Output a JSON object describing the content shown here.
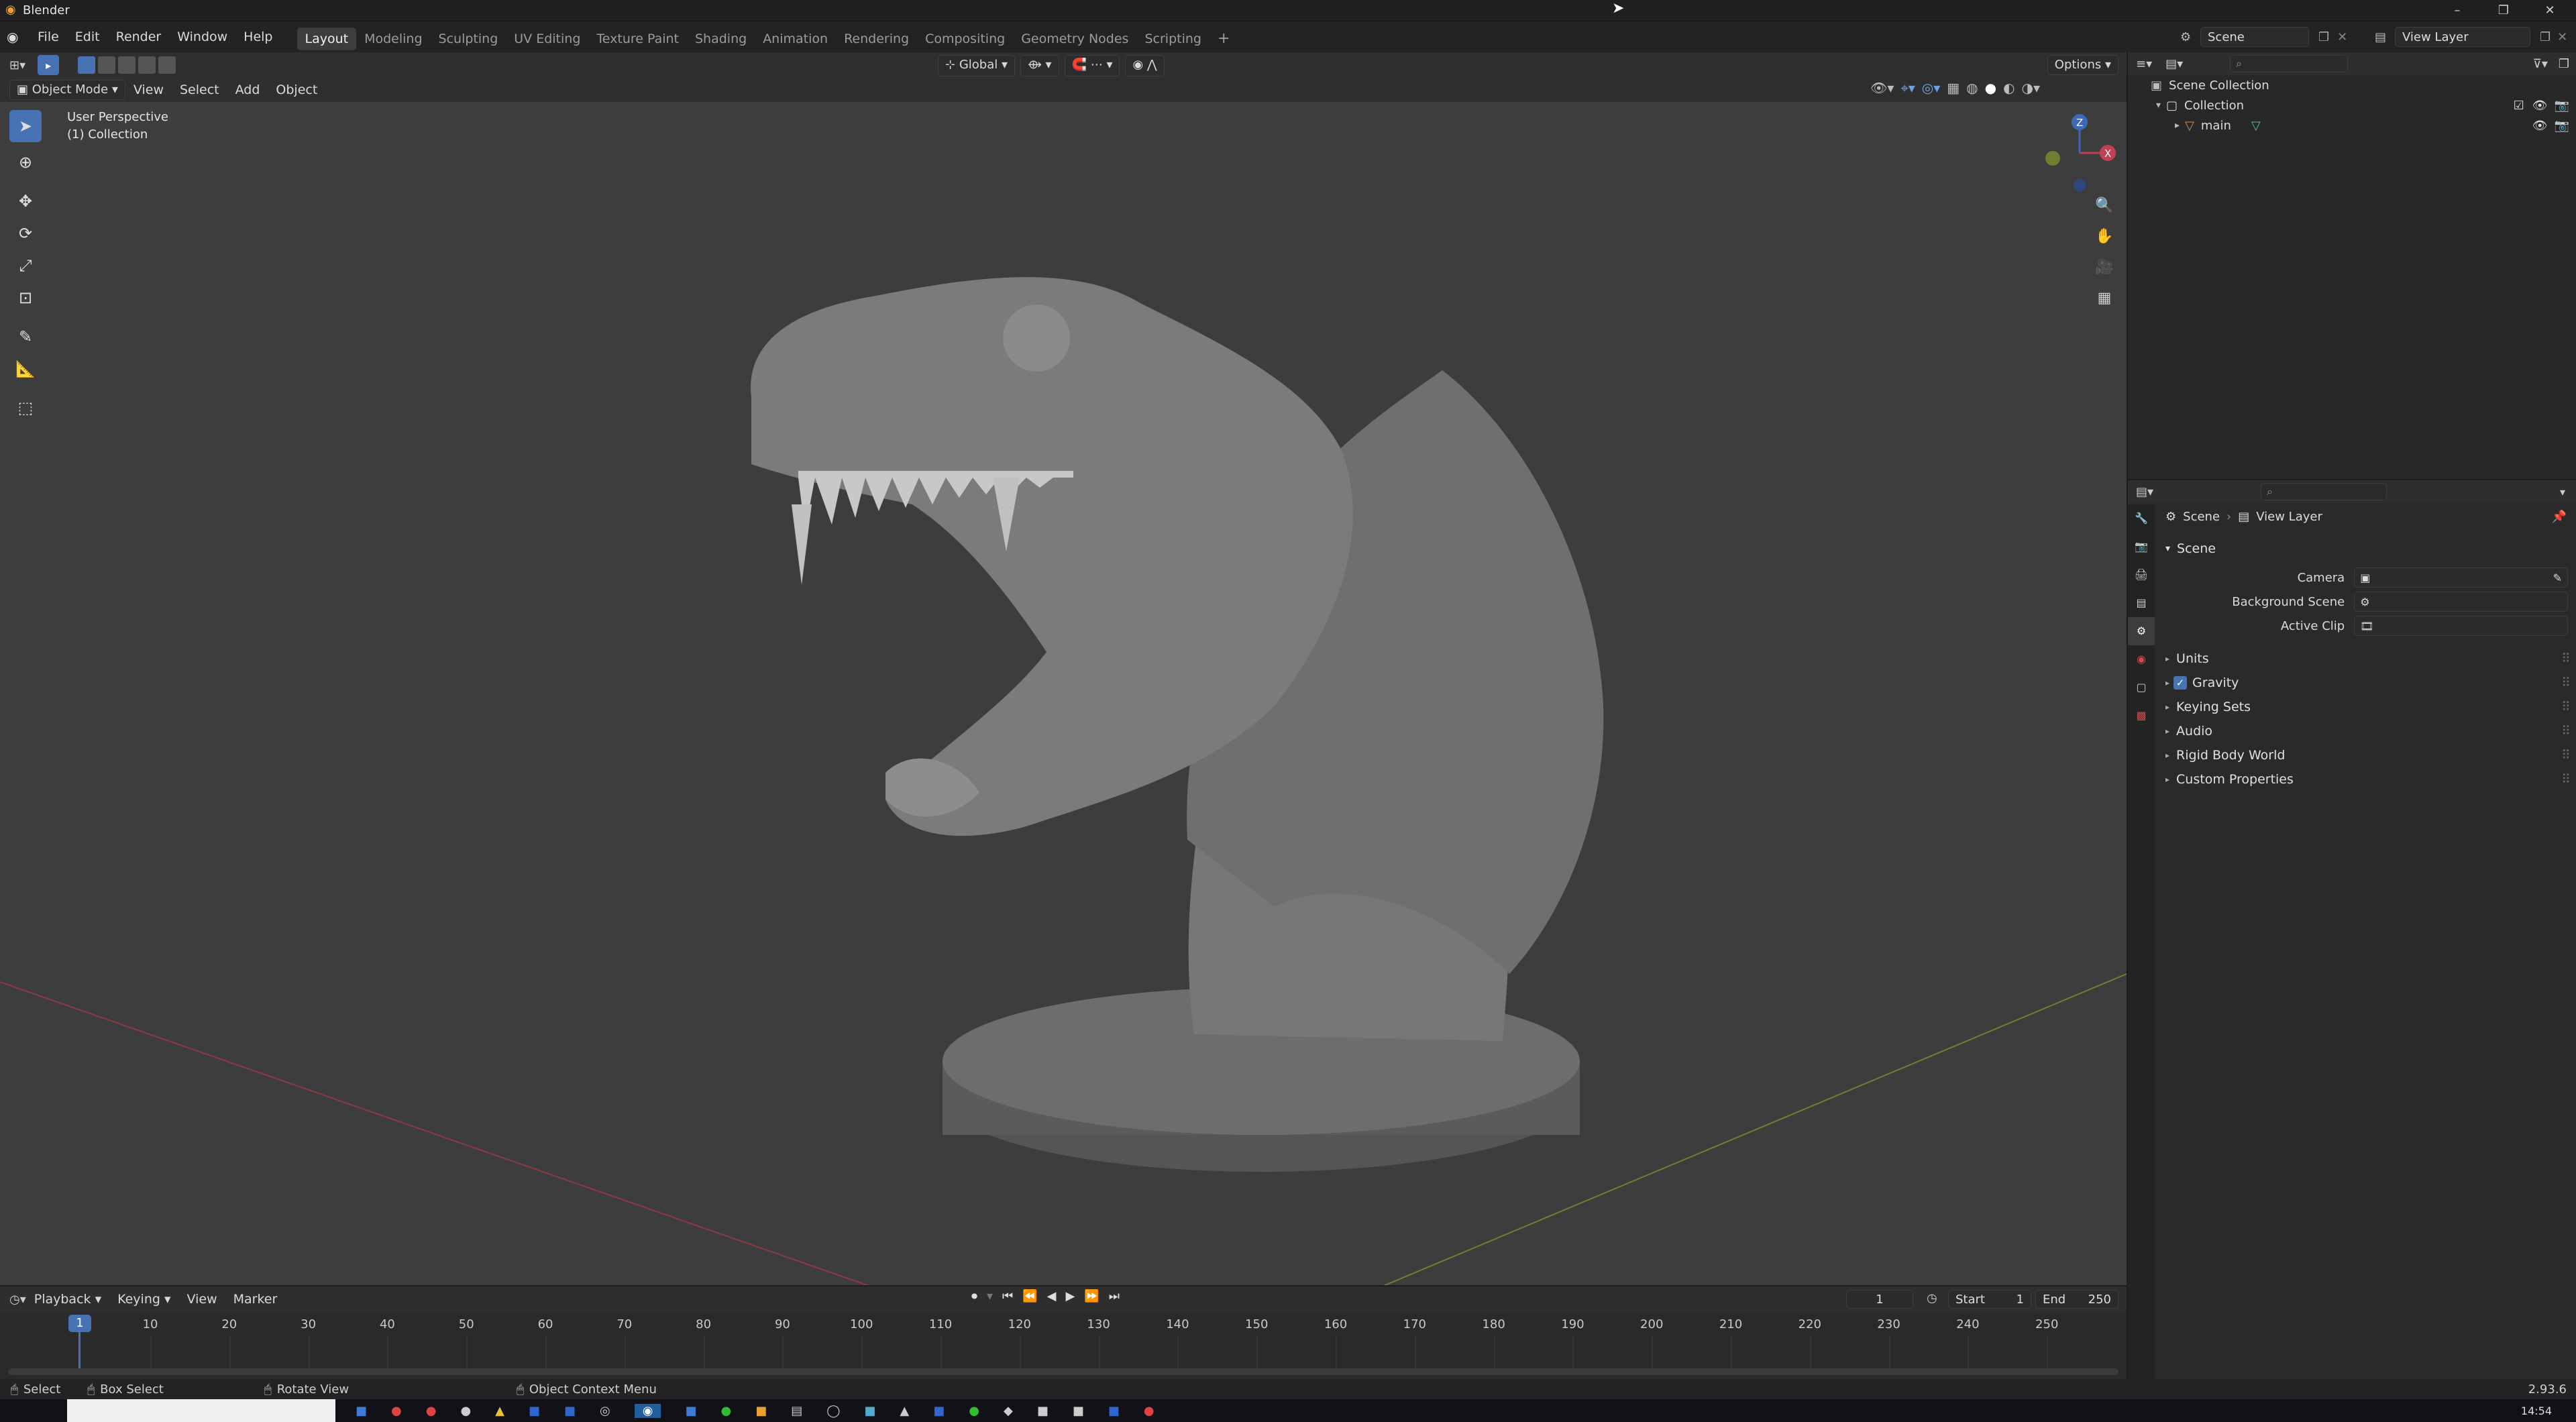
{
  "window": {
    "title": "Blender",
    "minimize": "–",
    "maximize": "❐",
    "close": "✕"
  },
  "menus": [
    "File",
    "Edit",
    "Render",
    "Window",
    "Help"
  ],
  "workspaces": [
    "Layout",
    "Modeling",
    "Sculpting",
    "UV Editing",
    "Texture Paint",
    "Shading",
    "Animation",
    "Rendering",
    "Compositing",
    "Geometry Nodes",
    "Scripting"
  ],
  "active_workspace": "Layout",
  "scene_field": "Scene",
  "viewlayer_field": "View Layer",
  "viewport_header": {
    "transform_orientation": "Global",
    "options": "Options",
    "mode": "Object Mode",
    "menus": [
      "View",
      "Select",
      "Add",
      "Object"
    ]
  },
  "viewport": {
    "perspective_label": "User Perspective",
    "collection_label": "(1) Collection",
    "axis_x": "X",
    "axis_y": "Y",
    "axis_z": "Z"
  },
  "outliner": {
    "root": "Scene Collection",
    "collection": "Collection",
    "object": "main"
  },
  "properties": {
    "breadcrumb_scene": "Scene",
    "breadcrumb_viewlayer": "View Layer",
    "section": "Scene",
    "fields": {
      "camera": "Camera",
      "background_scene": "Background Scene",
      "active_clip": "Active Clip"
    },
    "subsections": [
      "Units",
      "Gravity",
      "Keying Sets",
      "Audio",
      "Rigid Body World",
      "Custom Properties"
    ],
    "gravity_checked": true
  },
  "timeline": {
    "menus": [
      "Playback",
      "Keying",
      "View",
      "Marker"
    ],
    "current_frame": "1",
    "start_label": "Start",
    "start": "1",
    "end_label": "End",
    "end": "250",
    "ticks": [
      "10",
      "20",
      "30",
      "40",
      "50",
      "60",
      "70",
      "80",
      "90",
      "100",
      "110",
      "120",
      "130",
      "140",
      "150",
      "160",
      "170",
      "180",
      "190",
      "200",
      "210",
      "220",
      "230",
      "240",
      "250"
    ],
    "playhead": "1"
  },
  "statusbar": {
    "select": "Select",
    "box_select": "Box Select",
    "rotate_view": "Rotate View",
    "context_menu": "Object Context Menu",
    "version": "2.93.6"
  },
  "taskbar": {
    "clock": "14:54"
  },
  "colors": {
    "accent": "#4772b3",
    "x_axis": "#c04152",
    "y_axis": "#8aa33b",
    "z_axis": "#3c68b8"
  }
}
